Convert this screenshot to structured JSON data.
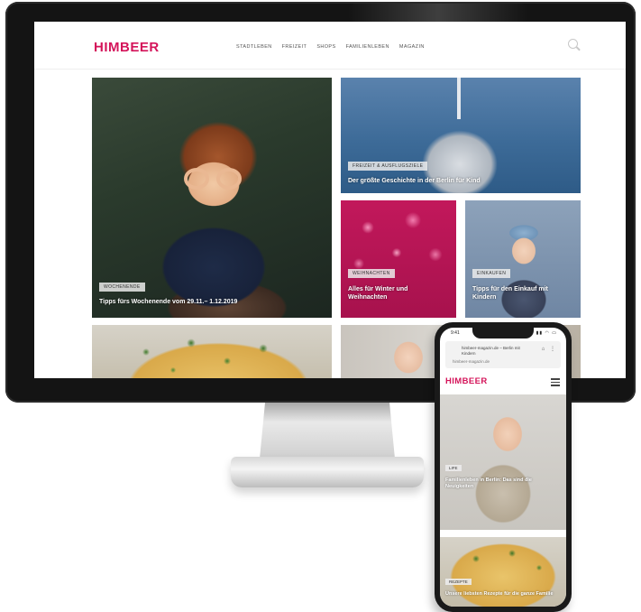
{
  "desktop": {
    "logo": "HIMBEER",
    "nav": [
      "STADTLEBEN",
      "FREIZEIT",
      "SHOPS",
      "FAMILIENLEBEN",
      "MAGAZIN"
    ],
    "cards": [
      {
        "kicker": "WOCHENENDE",
        "title": "Tipps fürs Wochenende vom 29.11.– 1.12.2019"
      },
      {
        "kicker": "FREIZEIT & AUSFLUGSZIELE",
        "title": "Der größte Geschichte in der Berlin für Kind"
      },
      {
        "kicker": "WEIHNACHTEN",
        "title": "Alles für Winter und Weihnachten"
      },
      {
        "kicker": "EINKAUFEN",
        "title": "Tipps für den Einkauf mit Kindern"
      },
      {
        "kicker": "",
        "title": ""
      },
      {
        "kicker": "",
        "title": ""
      }
    ]
  },
  "phone": {
    "status_time": "9:41",
    "status_icons": "▮▮ ◠ ▭",
    "url": "himbeer-magazin.de – Berlin mit Kindern",
    "tab": "himbeer-magazin.de",
    "browser_icons": "⌂ ⋮",
    "logo": "HIMBEER",
    "hero_kicker": "LIFE",
    "hero_title": "Familienleben in Berlin: Das sind die Neuigkeiten",
    "card2_kicker": "REZEPTE",
    "card2_title": "Unsere liebsten Rezepte für die ganze Familie"
  }
}
